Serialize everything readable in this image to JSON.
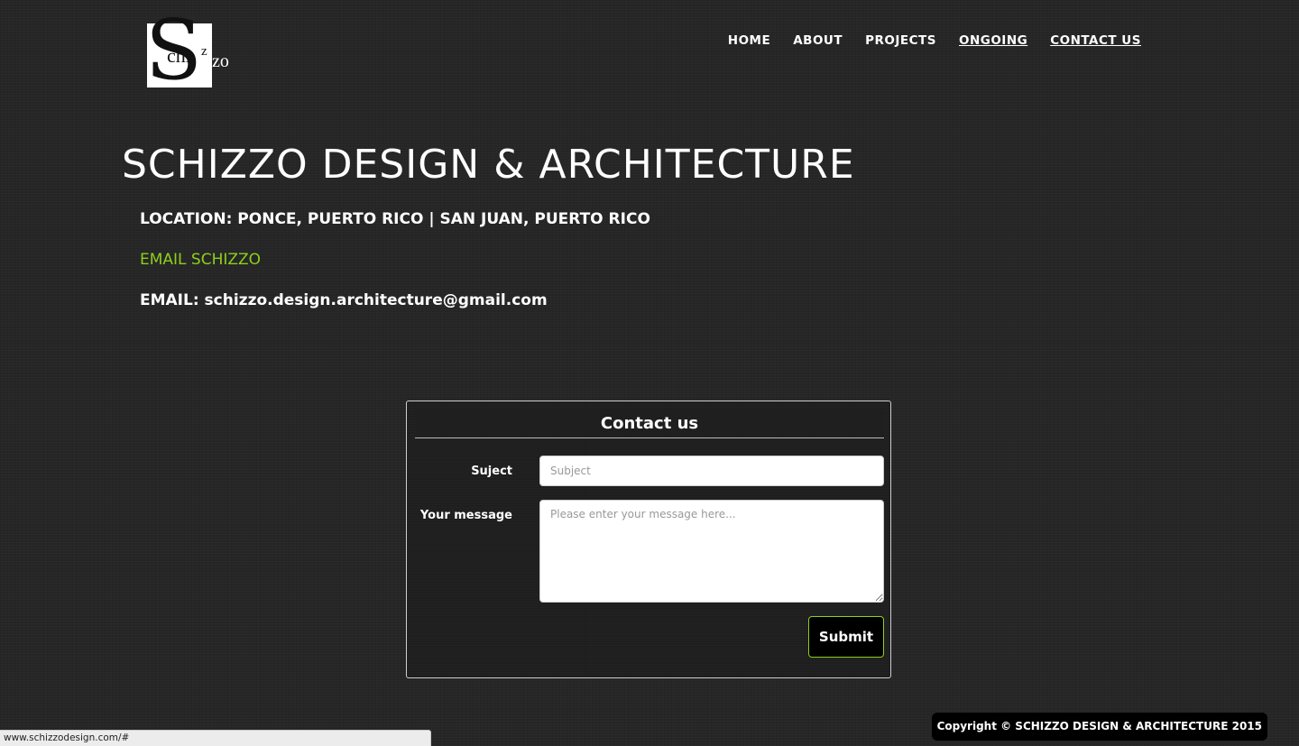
{
  "logo": {
    "big_letter": "S",
    "text_chi": "chi",
    "text_zz": "z",
    "text_zo": "zo"
  },
  "nav": {
    "items": [
      {
        "label": "HOME",
        "underlined": false
      },
      {
        "label": "ABOUT",
        "underlined": false
      },
      {
        "label": "PROJECTS",
        "underlined": false
      },
      {
        "label": "ONGOING",
        "underlined": true
      },
      {
        "label": "CONTACT US",
        "underlined": true
      }
    ]
  },
  "main": {
    "title": "SCHIZZO DESIGN & ARCHITECTURE",
    "location": "LOCATION: PONCE, PUERTO RICO | SAN JUAN, PUERTO RICO",
    "email_link": "EMAIL SCHIZZO",
    "email": "EMAIL: schizzo.design.architecture@gmail.com"
  },
  "contact_form": {
    "heading": "Contact us",
    "subject_label": "Suject",
    "subject_placeholder": "Subject",
    "message_label": "Your message",
    "message_placeholder": "Please enter your message here...",
    "submit_label": "Submit"
  },
  "footer": {
    "copyright": "Copyright © SCHIZZO DESIGN & ARCHITECTURE 2015"
  },
  "status_bar": {
    "url": "www.schizzodesign.com/#"
  },
  "colors": {
    "background": "#262626",
    "accent_green": "#8ecf1d",
    "text": "#ffffff"
  }
}
